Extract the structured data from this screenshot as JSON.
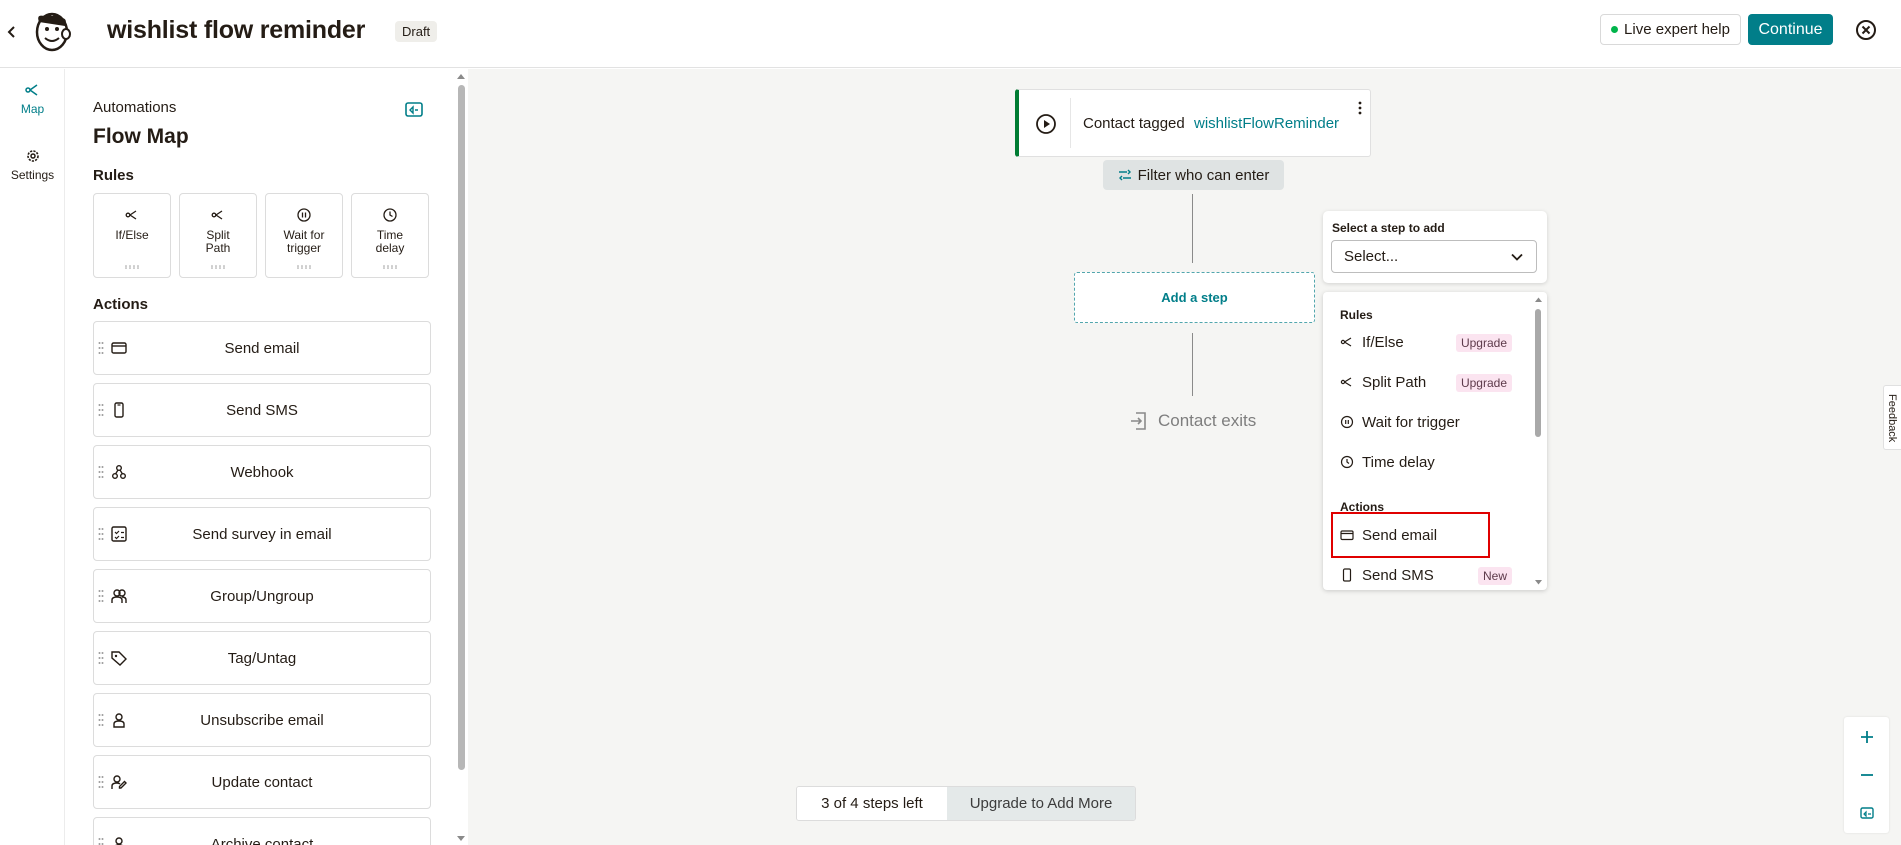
{
  "header": {
    "title": "wishlist flow reminder",
    "status": "Draft",
    "live_help": "Live expert help",
    "continue": "Continue",
    "icons": {
      "back": "chevron-left-icon",
      "logo": "mailchimp-freddie-logo",
      "close": "close-circle-icon"
    }
  },
  "rail": {
    "items": [
      {
        "label": "Map",
        "icon": "branch-icon",
        "active": true
      },
      {
        "label": "Settings",
        "icon": "gear-icon",
        "active": false
      }
    ]
  },
  "panel": {
    "subtitle": "Automations",
    "title": "Flow Map",
    "rules_heading": "Rules",
    "rules": [
      {
        "label": "If/Else",
        "icon": "branch-icon"
      },
      {
        "label": "Split Path",
        "icon": "split-icon"
      },
      {
        "label": "Wait for trigger",
        "icon": "pause-circle-icon"
      },
      {
        "label": "Time delay",
        "icon": "clock-icon"
      }
    ],
    "actions_heading": "Actions",
    "actions": [
      {
        "label": "Send email",
        "icon": "envelope-icon"
      },
      {
        "label": "Send SMS",
        "icon": "phone-icon"
      },
      {
        "label": "Webhook",
        "icon": "webhook-icon"
      },
      {
        "label": "Send survey in email",
        "icon": "survey-icon"
      },
      {
        "label": "Group/Ungroup",
        "icon": "group-icon"
      },
      {
        "label": "Tag/Untag",
        "icon": "tag-icon"
      },
      {
        "label": "Unsubscribe email",
        "icon": "user-icon"
      },
      {
        "label": "Update contact",
        "icon": "edit-contact-icon"
      },
      {
        "label": "Archive contact",
        "icon": "archive-icon"
      }
    ]
  },
  "canvas": {
    "trigger": {
      "label": "Contact tagged",
      "tag": "wishlistFlowReminder"
    },
    "filter_label": "Filter who can enter",
    "add_step_label": "Add a step",
    "exit_label": "Contact exits"
  },
  "step_picker": {
    "label": "Select a step to add",
    "placeholder": "Select...",
    "rules_heading": "Rules",
    "rules": [
      {
        "label": "If/Else",
        "badge": "Upgrade"
      },
      {
        "label": "Split Path",
        "badge": "Upgrade"
      },
      {
        "label": "Wait for trigger",
        "badge": ""
      },
      {
        "label": "Time delay",
        "badge": ""
      }
    ],
    "actions_heading": "Actions",
    "actions": [
      {
        "label": "Send email",
        "badge": "",
        "highlighted": true
      },
      {
        "label": "Send SMS",
        "badge": "New"
      }
    ]
  },
  "footer": {
    "steps_left": "3 of 4 steps left",
    "upgrade": "Upgrade to Add More"
  },
  "zoom": {
    "plus": "+",
    "minus": "−"
  },
  "feedback": "Feedback",
  "colors": {
    "accent": "#017e89",
    "trigger_border": "#007c33",
    "highlight": "#e00000",
    "badge_bg": "#fbe4f0"
  }
}
